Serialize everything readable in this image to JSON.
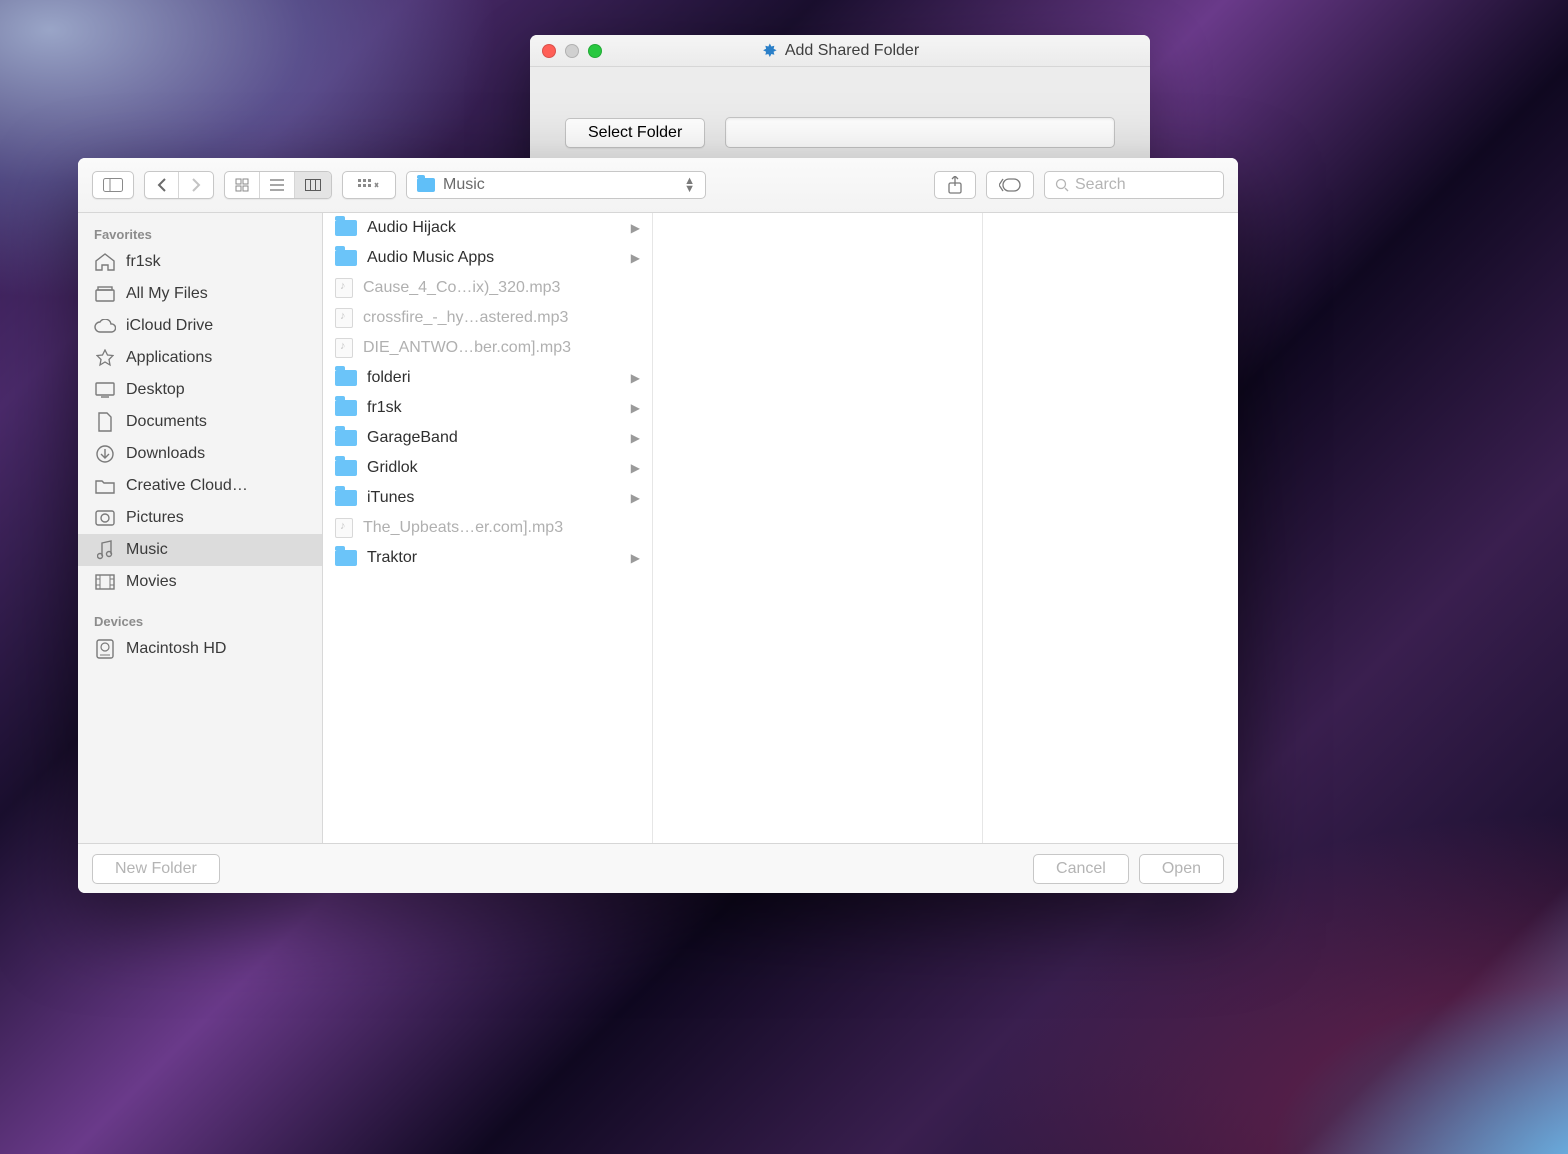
{
  "background_window": {
    "title": "Add Shared Folder",
    "select_button": "Select Folder",
    "path_value": ""
  },
  "finder": {
    "toolbar": {
      "path_label": "Music",
      "search_placeholder": "Search"
    },
    "sidebar": {
      "section1": "Favorites",
      "items1": [
        {
          "icon": "home",
          "label": "fr1sk"
        },
        {
          "icon": "allfiles",
          "label": "All My Files"
        },
        {
          "icon": "cloud",
          "label": "iCloud Drive"
        },
        {
          "icon": "apps",
          "label": "Applications"
        },
        {
          "icon": "desktop",
          "label": "Desktop"
        },
        {
          "icon": "docs",
          "label": "Documents"
        },
        {
          "icon": "downloads",
          "label": "Downloads"
        },
        {
          "icon": "folder",
          "label": "Creative Cloud…"
        },
        {
          "icon": "pictures",
          "label": "Pictures"
        },
        {
          "icon": "music",
          "label": "Music",
          "active": true
        },
        {
          "icon": "movies",
          "label": "Movies"
        }
      ],
      "section2": "Devices",
      "items2": [
        {
          "icon": "disk",
          "label": "Macintosh HD"
        }
      ]
    },
    "column": [
      {
        "type": "folder",
        "name": "Audio Hijack"
      },
      {
        "type": "folder",
        "name": "Audio Music Apps"
      },
      {
        "type": "file",
        "name": "Cause_4_Co…ix)_320.mp3"
      },
      {
        "type": "file",
        "name": "crossfire_-_hy…astered.mp3"
      },
      {
        "type": "file",
        "name": "DIE_ANTWO…ber.com].mp3"
      },
      {
        "type": "folder",
        "name": "folderi"
      },
      {
        "type": "folder",
        "name": "fr1sk"
      },
      {
        "type": "folder",
        "name": "GarageBand"
      },
      {
        "type": "folder",
        "name": "Gridlok"
      },
      {
        "type": "folder",
        "name": "iTunes"
      },
      {
        "type": "file",
        "name": "The_Upbeats…er.com].mp3"
      },
      {
        "type": "folder",
        "name": "Traktor"
      }
    ],
    "footer": {
      "new_folder": "New Folder",
      "cancel": "Cancel",
      "open": "Open"
    }
  }
}
